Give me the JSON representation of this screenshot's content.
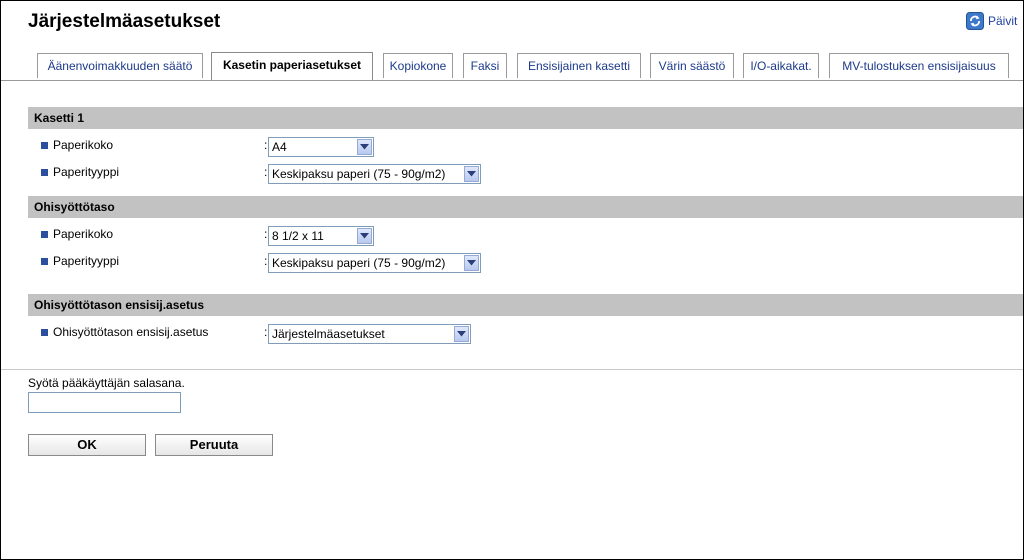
{
  "page": {
    "title": "Järjestelmäasetukset",
    "refresh_label": "Päivit"
  },
  "tabs": [
    {
      "label": "Äänenvoimakkuuden säätö"
    },
    {
      "label": "Kasetin paperiasetukset",
      "active": true
    },
    {
      "label": "Kopiokone"
    },
    {
      "label": "Faksi"
    },
    {
      "label": "Ensisijainen kasetti"
    },
    {
      "label": "Värin säästö"
    },
    {
      "label": "I/O-aikakat."
    },
    {
      "label": "MV-tulostuksen ensisijaisuus"
    }
  ],
  "sections": {
    "kasetti1": {
      "header": "Kasetti 1",
      "paper_size_label": "Paperikoko",
      "paper_size_value": "A4",
      "paper_type_label": "Paperityyppi",
      "paper_type_value": "Keskipaksu paperi (75 - 90g/m2)"
    },
    "bypass": {
      "header": "Ohisyöttötaso",
      "paper_size_label": "Paperikoko",
      "paper_size_value": "8 1/2 x 11",
      "paper_type_label": "Paperityyppi",
      "paper_type_value": "Keskipaksu paperi (75 - 90g/m2)"
    },
    "bypass_priority": {
      "header": "Ohisyöttötason ensisij.asetus",
      "setting_label": "Ohisyöttötason ensisij.asetus",
      "setting_value": "Järjestelmäasetukset"
    }
  },
  "colon": ":",
  "password": {
    "label": "Syötä pääkäyttäjän salasana.",
    "value": ""
  },
  "buttons": {
    "ok": "OK",
    "cancel": "Peruuta"
  },
  "colors": {
    "section_bar": "#c2c2c2",
    "tab_text": "#1d3a8a",
    "bullet": "#2b4f9e"
  },
  "icons": {
    "refresh": "refresh-icon",
    "dropdown": "chevron-down-icon",
    "bullet": "square-bullet-icon"
  }
}
